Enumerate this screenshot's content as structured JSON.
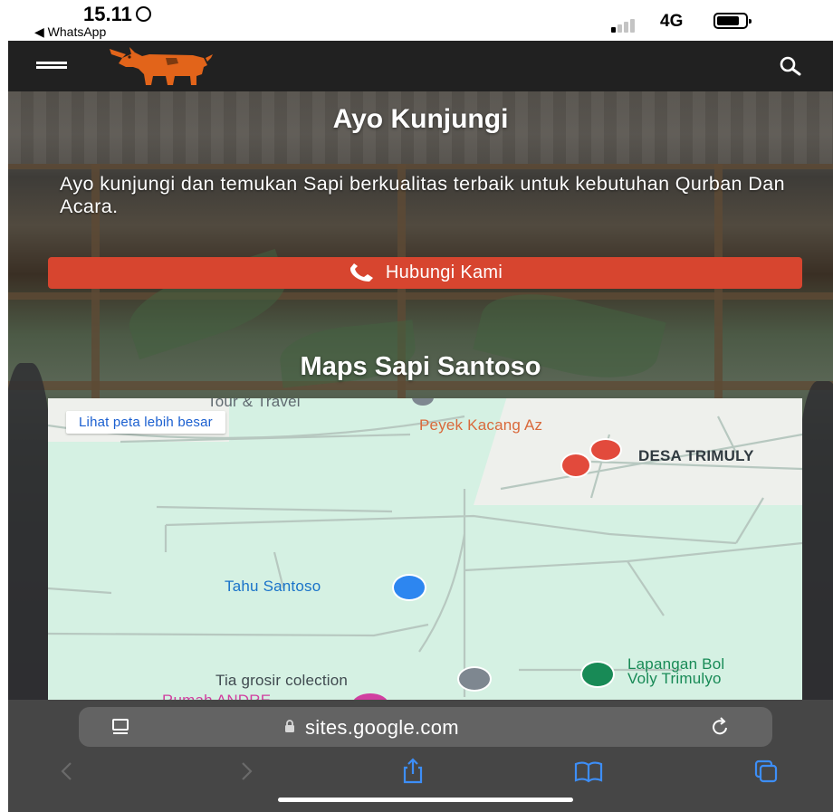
{
  "status_bar": {
    "time": "15.11",
    "back_app": "◀ WhatsApp",
    "network": "4G",
    "battery_level": 0.7,
    "signal_bars_active": 1
  },
  "nav": {
    "menu_icon": "hamburger-icon",
    "logo_icon": "cow-logo-icon",
    "search_icon": "search-icon"
  },
  "hero": {
    "title": "Ayo Kunjungi",
    "text": "Ayo kunjungi dan temukan Sapi berkualitas terbaik untuk kebutuhan Qurban Dan Acara.",
    "cta_label": "Hubungi Kami",
    "cta_icon": "phone-icon"
  },
  "maps": {
    "title": "Maps Sapi Santoso",
    "larger_map_link": "Lihat peta lebih besar",
    "pois": {
      "tour_travel": "Tour & Travel",
      "peyek": "Peyek Kacang Az",
      "desa": "DESA TRIMULY",
      "tahu": "Tahu Santoso",
      "lapangan_line1": "Lapangan Bol",
      "lapangan_line2": "Voly Trimulyo",
      "tia": "Tia grosir colection",
      "rumah": "Rumah ANDRE"
    }
  },
  "browser": {
    "url": "sites.google.com",
    "reader_icon": "reader-icon",
    "lock_icon": "lock-icon",
    "reload_icon": "reload-icon",
    "toolbar": [
      "back-icon",
      "forward-icon",
      "share-icon",
      "bookmarks-icon",
      "tabs-icon"
    ]
  },
  "colors": {
    "nav_bg": "#212121",
    "cta": "#d7452f",
    "map_bg": "#d5f1e3",
    "browser_bg": "#464646",
    "ios_blue": "#3d8ef7"
  }
}
